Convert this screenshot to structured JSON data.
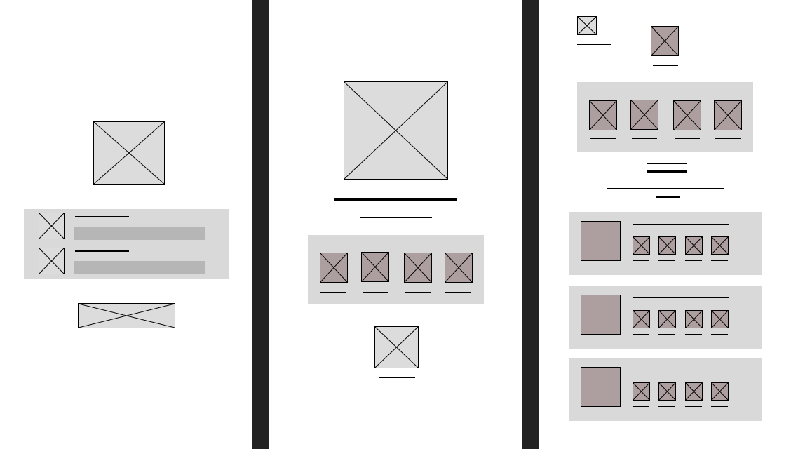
{
  "colors": {
    "background": "#ffffff",
    "divider": "#222222",
    "placeholder_light": "#dcdcdc",
    "placeholder_dark": "#ad9f9f",
    "card_background": "#d9d9d9",
    "input_field": "#b6b6b6",
    "line": "#000000"
  },
  "panels": [
    {
      "id": "left",
      "hero_image": "image-placeholder-icon",
      "list_rows": 2,
      "bottom_banner": "image-placeholder-icon"
    },
    {
      "id": "middle",
      "hero_image": "image-placeholder-icon",
      "thumbnail_count": 4,
      "footer_image": "image-placeholder-icon"
    },
    {
      "id": "right",
      "top_thumbnails": 2,
      "gallery_thumbnail_count": 4,
      "product_cards": 3,
      "product_card_thumbnail_count": 4
    }
  ]
}
